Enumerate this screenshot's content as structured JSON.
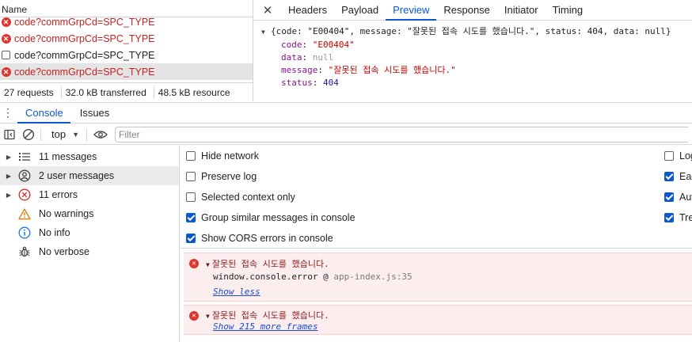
{
  "network": {
    "name_header": "Name",
    "requests": [
      {
        "name": "code?commGrpCd=SPC_TYPE",
        "status": "error"
      },
      {
        "name": "code?commGrpCd=SPC_TYPE",
        "status": "error"
      },
      {
        "name": "code?commGrpCd=SPC_TYPE",
        "status": "ok"
      },
      {
        "name": "code?commGrpCd=SPC_TYPE",
        "status": "error"
      }
    ],
    "status_bar": {
      "requests": "27 requests",
      "transferred": "32.0 kB transferred",
      "resources": "48.5 kB resource"
    }
  },
  "detail": {
    "tabs": [
      "Headers",
      "Payload",
      "Preview",
      "Response",
      "Initiator",
      "Timing"
    ],
    "active_tab": "Preview",
    "preview": {
      "summary": "{code: \"E00404\", message: \"잘못된 접속 시도를 했습니다.\", status: 404, data: null}",
      "fields": [
        {
          "key": "code",
          "value": "\"E00404\"",
          "kind": "string"
        },
        {
          "key": "data",
          "value": "null",
          "kind": "null"
        },
        {
          "key": "message",
          "value": "\"잘못된 접속 시도를 했습니다.\"",
          "kind": "string"
        },
        {
          "key": "status",
          "value": "404",
          "kind": "number"
        }
      ]
    }
  },
  "drawer": {
    "tabs": [
      "Console",
      "Issues"
    ],
    "active_tab": "Console"
  },
  "console": {
    "context": "top",
    "filter_placeholder": "Filter",
    "sidebar": [
      {
        "label": "11 messages",
        "icon": "list-icon",
        "expandable": true
      },
      {
        "label": "2 user messages",
        "icon": "user-icon",
        "expandable": true,
        "selected": true
      },
      {
        "label": "11 errors",
        "icon": "error-icon",
        "expandable": true
      },
      {
        "label": "No warnings",
        "icon": "warning-icon",
        "expandable": false
      },
      {
        "label": "No info",
        "icon": "info-icon",
        "expandable": false
      },
      {
        "label": "No verbose",
        "icon": "bug-icon",
        "expandable": false
      }
    ],
    "settings_left": [
      {
        "label": "Hide network",
        "checked": false
      },
      {
        "label": "Preserve log",
        "checked": false
      },
      {
        "label": "Selected context only",
        "checked": false
      },
      {
        "label": "Group similar messages in console",
        "checked": true
      },
      {
        "label": "Show CORS errors in console",
        "checked": true
      }
    ],
    "settings_right": [
      {
        "label": "Log",
        "checked": false
      },
      {
        "label": "Eag",
        "checked": true
      },
      {
        "label": "Aut",
        "checked": true
      },
      {
        "label": "Tre",
        "checked": true
      }
    ],
    "messages": [
      {
        "text": "잘못된 접속 시도를 했습니다.",
        "trace": "window.console.error @ ",
        "source": "app-index.js:35",
        "link": "Show less"
      },
      {
        "text": "잘못된 접속 시도를 했습니다.",
        "link": "Show 215 more frames"
      }
    ]
  },
  "colors": {
    "accent": "#0b57d0",
    "error": "#dc362e",
    "error_text": "#c5221f",
    "error_bg": "#fceeee"
  }
}
